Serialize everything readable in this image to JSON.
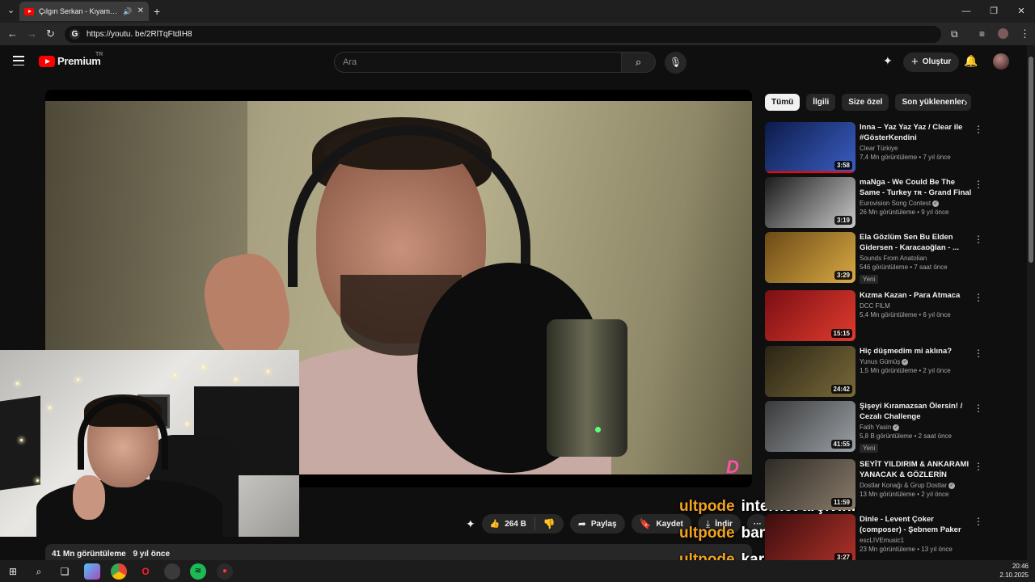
{
  "browser": {
    "tab_title": "Çılgın Serkan - Kıyamıyorum",
    "url": "https://youtu. be/2RlTqFtdIH8",
    "icons": [
      "chevron-down-icon",
      "youtube-favicon",
      "speaker-icon",
      "close-icon",
      "plus-icon",
      "back-icon",
      "forward-icon",
      "reload-icon",
      "extensions-icon",
      "media-icon",
      "profile-icon",
      "more-icon"
    ]
  },
  "header": {
    "logo_text": "Premium",
    "country": "TR",
    "search_placeholder": "Ara",
    "create_label": "Oluştur"
  },
  "video": {
    "watermark": "D",
    "views": "41 Mn görüntüleme",
    "age": "9 yıl önce",
    "actions": {
      "likes": "264 B",
      "share": "Paylaş",
      "save": "Kaydet",
      "download": "İndir"
    }
  },
  "chat": [
    {
      "user": "ultpode",
      "message": "internet arşivini"
    },
    {
      "user": "ultpode",
      "message": "bana sor"
    },
    {
      "user": "ultpode",
      "message": "kardeşim"
    }
  ],
  "sidebar": {
    "chips": [
      "Tümü",
      "İlgili",
      "Size özel",
      "Son yüklenenler"
    ],
    "active_chip": "Tümü",
    "recommendations": [
      {
        "title": "Inna – Yaz Yaz Yaz / Clear ile #GösterKendini",
        "channel": "Clear Türkiye",
        "verified": false,
        "views": "7,4 Mn görüntüleme",
        "age": "7 yıl önce",
        "duration": "3:58",
        "badge": "",
        "thumb_colors": [
          "#0d1b4a",
          "#3a5fc2"
        ]
      },
      {
        "title": "maNga - We Could Be The Same - Turkey ᴛʀ - Grand Final ...",
        "channel": "Eurovision Song Contest",
        "verified": true,
        "views": "26 Mn görüntüleme",
        "age": "9 yıl önce",
        "duration": "3:19",
        "badge": "",
        "thumb_colors": [
          "#1b1b1b",
          "#c9c9c9"
        ]
      },
      {
        "title": "Ela Gözlüm Sen Bu Elden Gidersen - Karacaoğlan - ...",
        "channel": "Sounds From Anatolian",
        "verified": false,
        "views": "546 görüntüleme",
        "age": "7 saat önce",
        "duration": "3:29",
        "badge": "Yeni",
        "thumb_colors": [
          "#6b4a16",
          "#d9a944"
        ]
      },
      {
        "title": "Kızma Kazan - Para Atmaca",
        "channel": "DCC FILM",
        "verified": false,
        "views": "5,4 Mn görüntüleme",
        "age": "6 yıl önce",
        "duration": "15:15",
        "badge": "",
        "thumb_colors": [
          "#7a0f14",
          "#e23b2e"
        ]
      },
      {
        "title": "Hiç düşmedim mi aklına?",
        "channel": "Yunus Gümüş",
        "verified": true,
        "views": "1,5 Mn görüntüleme",
        "age": "2 yıl önce",
        "duration": "24:42",
        "badge": "",
        "thumb_colors": [
          "#2a2414",
          "#7a6a3a"
        ]
      },
      {
        "title": "Şişeyi Kıramazsan Ölersin! / Cezalı Challenge",
        "channel": "Fatih Yasin",
        "verified": true,
        "views": "5,8 B görüntüleme",
        "age": "2 saat önce",
        "duration": "41:55",
        "badge": "Yeni",
        "thumb_colors": [
          "#3a3a3a",
          "#9aa0a6"
        ]
      },
      {
        "title": "SEYİT YILDIRIM & ANKARAMI YANACAK & GÖZLERİN YALA...",
        "channel": "Dostlar Konağı & Grup Dostlar",
        "verified": true,
        "views": "13 Mn görüntüleme",
        "age": "2 yıl önce",
        "duration": "11:59",
        "badge": "",
        "thumb_colors": [
          "#2d2a26",
          "#8a7c6a"
        ]
      },
      {
        "title": "Dinle - Levent Çoker (composer) - Şebnem Paker (voc.) ...",
        "channel": "escLIVEmusic1",
        "verified": false,
        "views": "23 Mn görüntüleme",
        "age": "13 yıl önce",
        "duration": "3:27",
        "badge": "",
        "thumb_colors": [
          "#3b0d0d",
          "#b0322a"
        ]
      }
    ]
  },
  "taskbar": {
    "time": "20:46",
    "date": "2.10.2025"
  },
  "colors": {
    "background": "#0f0f0f",
    "chip_active": "#f1f1f1",
    "brand_red": "#ff0000",
    "chat_user": "#f3a321"
  }
}
